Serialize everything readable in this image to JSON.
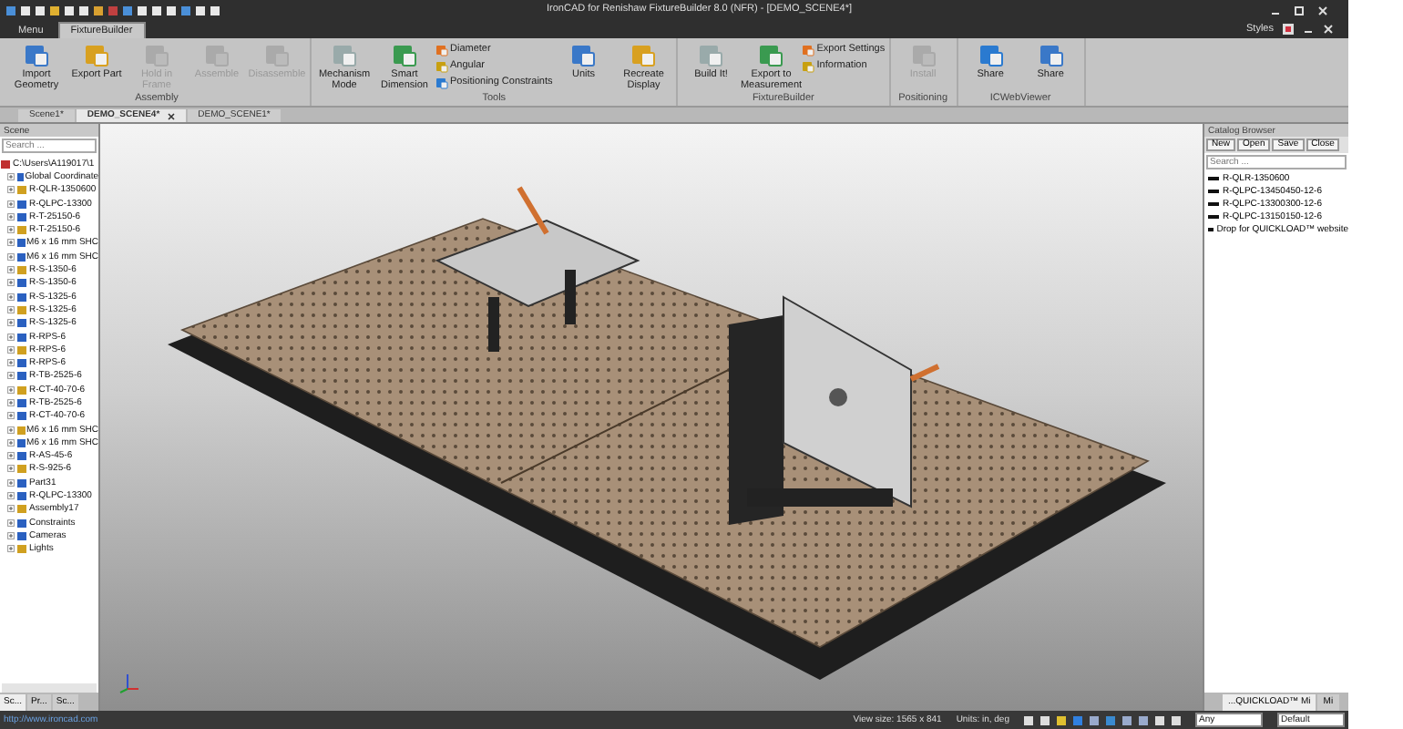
{
  "window": {
    "title": "IronCAD for Renishaw FixtureBuilder 8.0 (NFR) - [DEMO_SCENE4*]",
    "styles_label": "Styles"
  },
  "ribbon_tabs": [
    {
      "label": "Menu",
      "selected": false
    },
    {
      "label": "FixtureBuilder",
      "selected": true
    }
  ],
  "ribbon_groups": [
    {
      "label": "Assembly",
      "items": [
        {
          "kind": "large",
          "label": "Import Geometry",
          "disabled": false
        },
        {
          "kind": "large",
          "label": "Export Part",
          "disabled": false
        },
        {
          "kind": "large",
          "label": "Hold in Frame",
          "disabled": true
        },
        {
          "kind": "large",
          "label": "Assemble",
          "disabled": true
        },
        {
          "kind": "large",
          "label": "Disassemble",
          "disabled": true
        }
      ]
    },
    {
      "label": "Tools",
      "items": [
        {
          "kind": "large",
          "label": "Mechanism Mode",
          "disabled": false
        },
        {
          "kind": "large",
          "label": "Smart Dimension",
          "disabled": false
        },
        {
          "kind": "small",
          "label": "Diameter",
          "disabled": false
        },
        {
          "kind": "small",
          "label": "Angular",
          "disabled": false
        },
        {
          "kind": "small",
          "label": "Positioning Constraints",
          "disabled": false
        },
        {
          "kind": "large",
          "label": "Units",
          "disabled": false
        },
        {
          "kind": "large",
          "label": "Recreate Display",
          "disabled": false
        }
      ]
    },
    {
      "label": "FixtureBuilder",
      "items": [
        {
          "kind": "large",
          "label": "Build It!",
          "disabled": false
        },
        {
          "kind": "large",
          "label": "Export to Measurement",
          "disabled": false
        },
        {
          "kind": "small",
          "label": "Export Settings",
          "disabled": false
        },
        {
          "kind": "small",
          "label": "Information",
          "disabled": false
        }
      ]
    },
    {
      "label": "Positioning",
      "items": [
        {
          "kind": "large",
          "label": "Install",
          "disabled": true
        }
      ]
    },
    {
      "label": "ICWebViewer",
      "items": [
        {
          "kind": "large",
          "label": "Share",
          "disabled": false
        },
        {
          "kind": "large",
          "label": "Share",
          "disabled": false
        }
      ]
    }
  ],
  "document_tabs": [
    {
      "label": "Scene1*",
      "selected": false
    },
    {
      "label": "DEMO_SCENE4*",
      "selected": true
    },
    {
      "label": "DEMO_SCENE1*",
      "selected": false
    }
  ],
  "scene_panel": {
    "title": "Scene",
    "search": {
      "placeholder": "Search ..."
    },
    "tree": [
      {
        "label": "C:\\Users\\A119017\\1",
        "children": [
          {
            "label": "Global Coordinate",
            "expanded": false
          },
          {
            "label": "R-QLR-1350600",
            "expanded": false
          },
          {
            "label": "R-QLPC-13300",
            "expanded": false
          },
          {
            "label": "R-T-25150-6",
            "expanded": false
          },
          {
            "label": "R-T-25150-6",
            "expanded": false
          },
          {
            "label": "M6 x 16 mm SHC",
            "expanded": false
          },
          {
            "label": "M6 x 16 mm SHC",
            "expanded": false
          },
          {
            "label": "R-S-1350-6",
            "expanded": false
          },
          {
            "label": "R-S-1350-6",
            "expanded": false
          },
          {
            "label": "R-S-1325-6",
            "expanded": false
          },
          {
            "label": "R-S-1325-6",
            "expanded": false
          },
          {
            "label": "R-S-1325-6",
            "expanded": false
          },
          {
            "label": "R-RPS-6",
            "expanded": false
          },
          {
            "label": "R-RPS-6",
            "expanded": false
          },
          {
            "label": "R-RPS-6",
            "expanded": false
          },
          {
            "label": "R-TB-2525-6",
            "expanded": false
          },
          {
            "label": "R-CT-40-70-6",
            "expanded": false
          },
          {
            "label": "R-TB-2525-6",
            "expanded": false
          },
          {
            "label": "R-CT-40-70-6",
            "expanded": false
          },
          {
            "label": "M6 x 16 mm SHC",
            "expanded": false
          },
          {
            "label": "M6 x 16 mm SHC",
            "expanded": false
          },
          {
            "label": "R-AS-45-6",
            "expanded": false
          },
          {
            "label": "R-S-925-6",
            "expanded": false
          },
          {
            "label": "Part31",
            "expanded": false
          },
          {
            "label": "R-QLPC-13300",
            "expanded": false
          },
          {
            "label": "Assembly17",
            "expanded": false
          },
          {
            "label": "Constraints",
            "expanded": false
          },
          {
            "label": "Cameras",
            "expanded": false
          },
          {
            "label": "Lights",
            "expanded": false
          }
        ]
      }
    ],
    "bottom_tabs": [
      {
        "label": "Sc...",
        "selected": true
      },
      {
        "label": "Pr...",
        "selected": false
      },
      {
        "label": "Sc...",
        "selected": false
      }
    ]
  },
  "catalog_panel": {
    "title": "Catalog Browser",
    "buttons": [
      "New",
      "Open",
      "Save",
      "Close"
    ],
    "search": {
      "placeholder": "Search ..."
    },
    "items": [
      "R-QLR-1350600",
      "R-QLPC-13450450-12-6",
      "R-QLPC-13300300-12-6",
      "R-QLPC-13150150-12-6",
      "Drop for QUICKLOAD™ website"
    ],
    "bottom_tabs": [
      {
        "label": "...QUICKLOAD™ Mi",
        "selected": true
      },
      {
        "label": "Mi",
        "selected": false
      }
    ]
  },
  "status_bar": {
    "link": "http://www.ironcad.com",
    "view_size": "View size: 1565 x 841",
    "units": "Units: in, deg",
    "filter_dropdown": "Any",
    "style_dropdown": "Default"
  }
}
